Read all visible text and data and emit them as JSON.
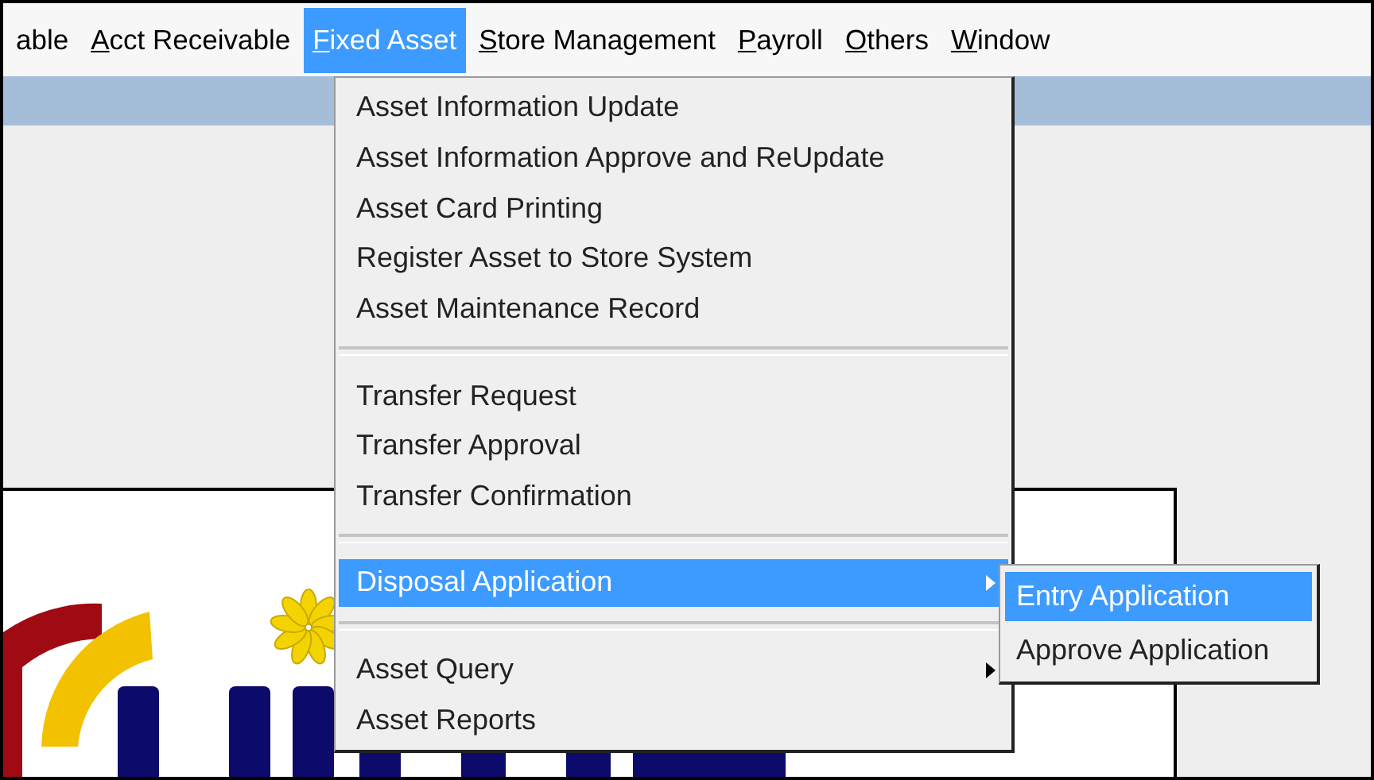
{
  "menubar": {
    "items": [
      {
        "label": "able",
        "selected": false,
        "access_key": false
      },
      {
        "label": "Acct Receivable",
        "selected": false,
        "access_key": true
      },
      {
        "label": "Fixed Asset",
        "selected": true,
        "access_key": true
      },
      {
        "label": "Store Management",
        "selected": false,
        "access_key": true
      },
      {
        "label": "Payroll",
        "selected": false,
        "access_key": true
      },
      {
        "label": "Others",
        "selected": false,
        "access_key": true
      },
      {
        "label": "Window",
        "selected": false,
        "access_key": true
      }
    ]
  },
  "menu": {
    "items": [
      {
        "kind": "item",
        "label": "Asset Information Update",
        "selected": false,
        "has_submenu": false
      },
      {
        "kind": "item",
        "label": "Asset Information Approve and ReUpdate",
        "selected": false,
        "has_submenu": false
      },
      {
        "kind": "item",
        "label": "Asset Card Printing",
        "selected": false,
        "has_submenu": false
      },
      {
        "kind": "item",
        "label": "Register Asset to Store System",
        "selected": false,
        "has_submenu": false
      },
      {
        "kind": "item",
        "label": "Asset Maintenance Record",
        "selected": false,
        "has_submenu": false
      },
      {
        "kind": "separator"
      },
      {
        "kind": "item",
        "label": "Transfer Request",
        "selected": false,
        "has_submenu": false
      },
      {
        "kind": "item",
        "label": "Transfer Approval",
        "selected": false,
        "has_submenu": false
      },
      {
        "kind": "item",
        "label": "Transfer Confirmation",
        "selected": false,
        "has_submenu": false
      },
      {
        "kind": "separator"
      },
      {
        "kind": "item",
        "label": "Disposal Application",
        "selected": true,
        "has_submenu": true
      },
      {
        "kind": "separator"
      },
      {
        "kind": "item",
        "label": "Asset Query",
        "selected": false,
        "has_submenu": true
      },
      {
        "kind": "item",
        "label": "Asset Reports",
        "selected": false,
        "has_submenu": false
      }
    ]
  },
  "submenu": {
    "items": [
      {
        "label": "Entry Application",
        "selected": true
      },
      {
        "label": "Approve Application",
        "selected": false
      }
    ]
  }
}
